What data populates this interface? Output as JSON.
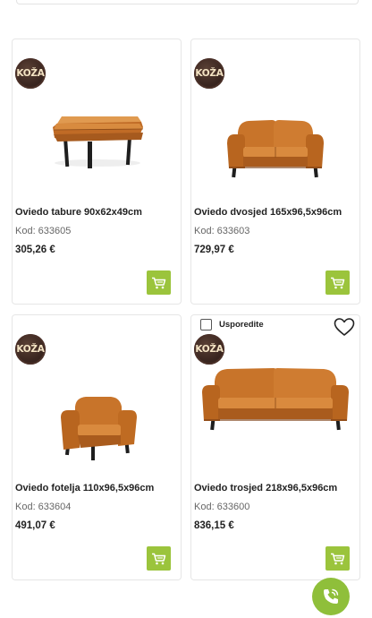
{
  "brand_badge": "KOŽA",
  "compare_label": "Usporedite",
  "products": [
    {
      "name": "Oviedo tabure 90x62x49cm",
      "code": "Kod: 633605",
      "price": "305,26 €"
    },
    {
      "name": "Oviedo dvosjed 165x96,5x96cm",
      "code": "Kod: 633603",
      "price": "729,97 €"
    },
    {
      "name": "Oviedo fotelja 110x96,5x96cm",
      "code": "Kod: 633604",
      "price": "491,07 €"
    },
    {
      "name": "Oviedo trosjed 218x96,5x96cm",
      "code": "Kod: 633600",
      "price": "836,15 €"
    }
  ],
  "colors": {
    "accent": "#9bc43c",
    "leather": "#c8742a",
    "badge": "#3a2620"
  }
}
